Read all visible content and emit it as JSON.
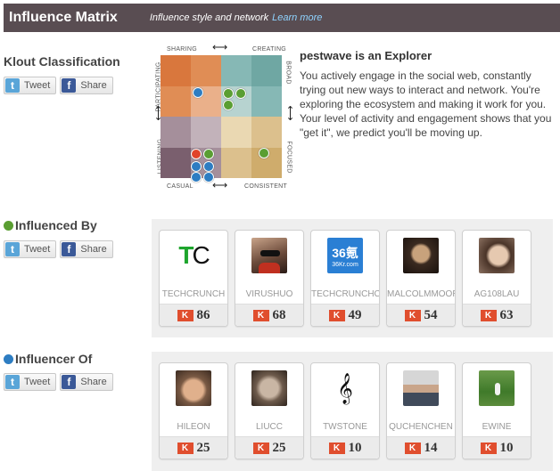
{
  "header": {
    "title": "Influence Matrix",
    "subtitle": "Influence style and network",
    "link": "Learn more"
  },
  "share": {
    "tweet": "Tweet",
    "share": "Share"
  },
  "classification": {
    "section_title": "Klout Classification",
    "title": "pestwave is an Explorer",
    "description": "You actively engage in the social web, constantly trying out new ways to interact and network. You're exploring the ecosystem and making it work for you. Your level of activity and engagement shows that you \"get it\", we predict you'll be moving up."
  },
  "matrix": {
    "top_left": "SHARING",
    "top_right": "CREATING",
    "bottom_left": "CASUAL",
    "bottom_right": "CONSISTENT",
    "left_top": "PARTICIPATING",
    "left_bottom": "LISTENING",
    "right_top": "BROAD",
    "right_bottom": "FOCUSED",
    "colors": {
      "blue": "#2d7dc2",
      "green": "#5a9e32",
      "red": "#e0432a"
    }
  },
  "influenced_by": {
    "title": "Influenced By",
    "dot_color": "#5a9e32",
    "people": [
      {
        "name": "TECHCRUNCH",
        "score": "86",
        "avatar_text": "TC"
      },
      {
        "name": "VIRUSHUO",
        "score": "68",
        "avatar_text": ""
      },
      {
        "name": "TECHCRUNCHC",
        "score": "49",
        "avatar_text": "36氪",
        "avatar_sub": "36Kr.com"
      },
      {
        "name": "MALCOLMMOOR",
        "score": "54",
        "avatar_text": ""
      },
      {
        "name": "AG108LAU",
        "score": "63",
        "avatar_text": ""
      }
    ]
  },
  "influencer_of": {
    "title": "Influencer Of",
    "dot_color": "#2d7dc2",
    "people": [
      {
        "name": "HILEON",
        "score": "25"
      },
      {
        "name": "LIUCC",
        "score": "25"
      },
      {
        "name": "TWSTONE",
        "score": "10",
        "avatar_text": "𝄞"
      },
      {
        "name": "QUCHENCHEN",
        "score": "14"
      },
      {
        "name": "EWINE",
        "score": "10"
      }
    ]
  }
}
